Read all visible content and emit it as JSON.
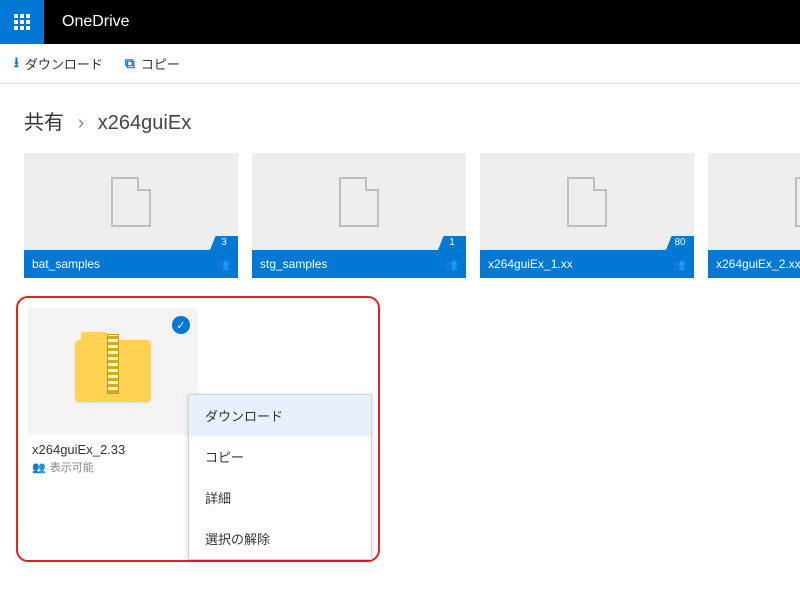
{
  "header": {
    "brand": "OneDrive"
  },
  "toolbar": {
    "download": "ダウンロード",
    "copy": "コピー"
  },
  "breadcrumb": {
    "root": "共有",
    "current": "x264guiEx"
  },
  "tiles": [
    {
      "name": "bat_samples",
      "count": "3"
    },
    {
      "name": "stg_samples",
      "count": "1"
    },
    {
      "name": "x264guiEx_1.xx",
      "count": "80"
    },
    {
      "name": "x264guiEx_2.xx",
      "count": ""
    }
  ],
  "selected_file": {
    "name": "x264guiEx_2.33",
    "sub": "表示可能"
  },
  "context_menu": {
    "download": "ダウンロード",
    "copy": "コピー",
    "details": "詳細",
    "deselect": "選択の解除"
  }
}
